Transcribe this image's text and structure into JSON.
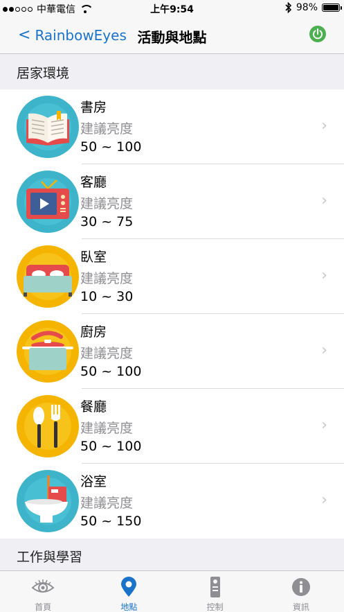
{
  "status_bar": {
    "carrier": "中華電信",
    "time": "上午9:54",
    "battery": "98%",
    "battery_level": 0.98,
    "signal_dots_filled": 2,
    "signal_dots_total": 5
  },
  "nav": {
    "back_label": "RainbowEyes",
    "title": "活動與地點",
    "accent_color": "#1a73c8",
    "power_color": "#4caf50"
  },
  "sections": [
    {
      "title": "居家環境",
      "items": [
        {
          "title": "書房",
          "subtitle": "建議亮度",
          "range": "50 ~ 100",
          "icon": "book-icon",
          "bg": "#3db4c9"
        },
        {
          "title": "客廳",
          "subtitle": "建議亮度",
          "range": "30 ~ 75",
          "icon": "tv-icon",
          "bg": "#3db4c9"
        },
        {
          "title": "臥室",
          "subtitle": "建議亮度",
          "range": "10 ~ 30",
          "icon": "bed-icon",
          "bg": "#f5b400"
        },
        {
          "title": "廚房",
          "subtitle": "建議亮度",
          "range": "50 ~ 100",
          "icon": "pot-icon",
          "bg": "#f5b400"
        },
        {
          "title": "餐廳",
          "subtitle": "建議亮度",
          "range": "50 ~ 100",
          "icon": "utensils-icon",
          "bg": "#f5b400"
        },
        {
          "title": "浴室",
          "subtitle": "建議亮度",
          "range": "50 ~ 150",
          "icon": "toilet-icon",
          "bg": "#3db4c9"
        }
      ]
    },
    {
      "title": "工作與學習"
    }
  ],
  "tabs": [
    {
      "label": "首頁",
      "icon": "eye-icon",
      "active": false
    },
    {
      "label": "地點",
      "icon": "location-pin-icon",
      "active": true
    },
    {
      "label": "控制",
      "icon": "remote-control-icon",
      "active": false
    },
    {
      "label": "資訊",
      "icon": "info-icon",
      "active": false
    }
  ]
}
